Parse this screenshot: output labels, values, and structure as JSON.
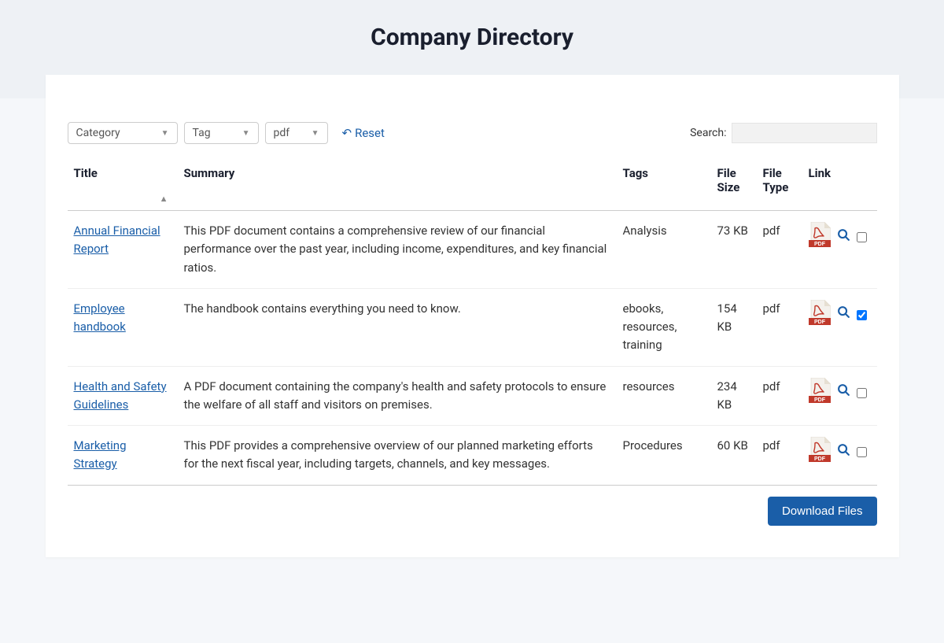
{
  "header": {
    "title": "Company Directory"
  },
  "filters": {
    "category_label": "Category",
    "tag_label": "Tag",
    "type_value": "pdf",
    "reset_label": "Reset"
  },
  "search": {
    "label": "Search:"
  },
  "columns": {
    "title": "Title",
    "summary": "Summary",
    "tags": "Tags",
    "size": "File Size",
    "type": "File Type",
    "link": "Link"
  },
  "rows": [
    {
      "title": "Annual Financial Report",
      "summary": "This PDF document contains a comprehensive review of our financial performance over the past year, including income, expenditures, and key financial ratios.",
      "tags": "Analysis",
      "size": "73 KB",
      "type": "pdf",
      "checked": false
    },
    {
      "title": "Employee handbook",
      "summary": "The handbook contains everything you need to know.",
      "tags": "ebooks, resources, training",
      "size": "154 KB",
      "type": "pdf",
      "checked": true
    },
    {
      "title": "Health and Safety Guidelines",
      "summary": "A PDF document containing the company's health and safety protocols to ensure the welfare of all staff and visitors on premises.",
      "tags": "resources",
      "size": "234 KB",
      "type": "pdf",
      "checked": false
    },
    {
      "title": "Marketing Strategy",
      "summary": "This PDF provides a comprehensive overview of our planned marketing efforts for the next fiscal year, including targets, channels, and key messages.",
      "tags": "Procedures",
      "size": "60 KB",
      "type": "pdf",
      "checked": false
    }
  ],
  "download_button": "Download Files"
}
